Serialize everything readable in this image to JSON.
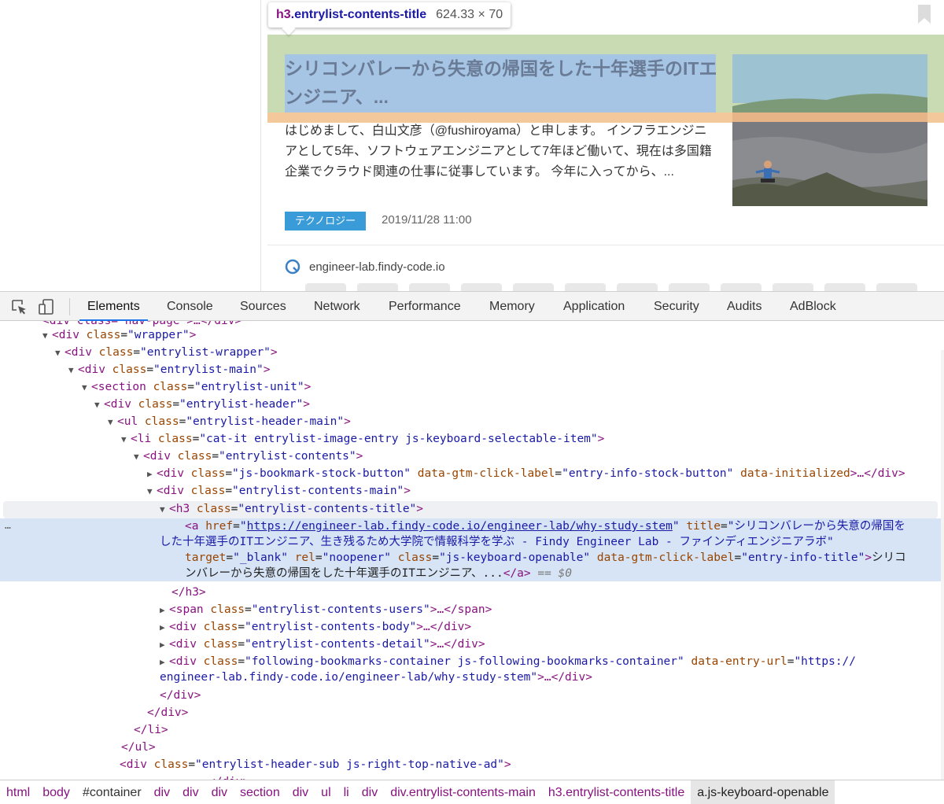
{
  "tooltip": {
    "tag": "h3",
    "class": ".entrylist-contents-title",
    "size": "624.33 × 70"
  },
  "entry": {
    "title": "シリコンバレーから失意の帰国をした十年選手のITエンジニア、...",
    "body": "はじめまして、白山文彦（@fushiroyama）と申します。 インフラエンジニアとして5年、ソフトウェアエンジニアとして7年ほど働いて、現在は多国籍企業でクラウド関連の仕事に従事しています。 今年に入ってから、...",
    "category": "テクノロジー",
    "date": "2019/11/28 11:00",
    "site": "engineer-lab.findy-code.io"
  },
  "devtools": {
    "tabs": [
      "Elements",
      "Console",
      "Sources",
      "Network",
      "Performance",
      "Memory",
      "Application",
      "Security",
      "Audits",
      "AdBlock"
    ],
    "active_tab": "Elements"
  },
  "dom": {
    "l0": "<div class=\"nav-page\">…</div>",
    "l1_tag": "<div ",
    "l1_attr": "class",
    "l1_val": "\"wrapper\"",
    "l2_val": "\"entrylist-wrapper\"",
    "l3_val": "\"entrylist-main\"",
    "l4_val": "\"entrylist-unit\"",
    "l5_val": "\"entrylist-header\"",
    "l6_val": "\"entrylist-header-main\"",
    "l7_val": "\"cat-it entrylist-image-entry js-keyboard-selectable-item\"",
    "l8_val": "\"entrylist-contents\"",
    "l9_val": "\"js-bookmark-stock-button\"",
    "l9_attr2": "data-gtm-click-label",
    "l9_val2": "\"entry-info-stock-button\"",
    "l9_attr3": "data-initialized",
    "l10_val": "\"entrylist-contents-main\"",
    "l11_val": "\"entrylist-contents-title\"",
    "a_href": "https://engineer-lab.findy-code.io/engineer-lab/why-study-stem",
    "a_title_1": "\"シリコンバレーから失意の帰国を",
    "a_title_2": "した十年選手のITエンジニア、生き残るため大学院で情報科学を学ぶ - Findy Engineer Lab - ファインディエンジニアラボ\"",
    "a_target": "\"_blank\"",
    "a_rel": "\"noopener\"",
    "a_class": "\"js-keyboard-openable\"",
    "a_gtm": "\"entry-info-title\"",
    "a_text_1": "シリコ",
    "a_text_2": "ンバレーから失意の帰国をした十年選手のITエンジニア、...",
    "a_eq": "== $0",
    "l13_val": "\"entrylist-contents-users\"",
    "l14_val": "\"entrylist-contents-body\"",
    "l15_val": "\"entrylist-contents-detail\"",
    "l16_val": "\"following-bookmarks-container js-following-bookmarks-container\"",
    "l16_attr2": "data-entry-url",
    "l16_val2a": "\"https://",
    "l16_val2b": "engineer-lab.findy-code.io/engineer-lab/why-study-stem\"",
    "l23_val": "\"entrylist-header-sub js-right-top-native-ad\""
  },
  "breadcrumbs": [
    "html",
    "body",
    "#container",
    "div",
    "div",
    "div",
    "section",
    "div",
    "ul",
    "li",
    "div",
    "div.entrylist-contents-main",
    "h3.entrylist-contents-title",
    "a.js-keyboard-openable"
  ],
  "colors": {
    "tag": "#881280",
    "attr": "#994500",
    "value": "#1a1aa6",
    "highlight_content": "#a6c4e4",
    "highlight_padding": "#c9dbb3",
    "highlight_margin": "#f3c99b",
    "category_badge": "#3a9bd9"
  }
}
